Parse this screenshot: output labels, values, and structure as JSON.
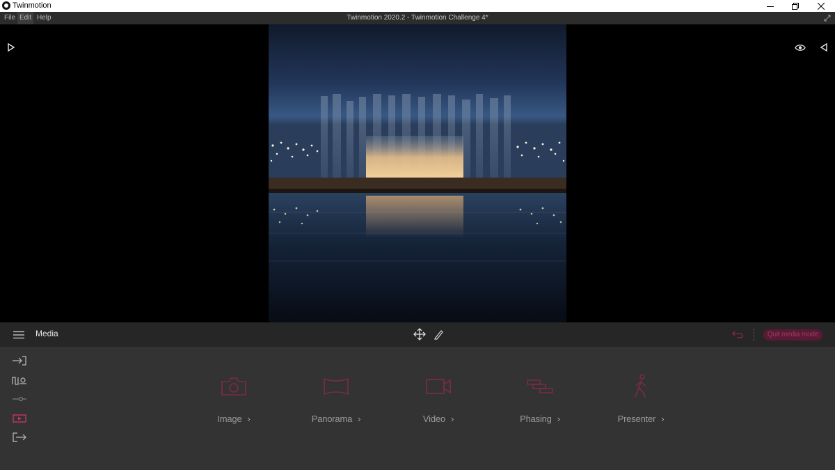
{
  "window": {
    "app_name": "Twinmotion",
    "title": "Twinmotion 2020.2 - Twinmotion Challenge 4*"
  },
  "menu": {
    "items": [
      {
        "label": "File"
      },
      {
        "label": "Edit"
      },
      {
        "label": "Help"
      }
    ]
  },
  "viewport": {
    "icons": [
      "play-right-icon",
      "eye-icon",
      "collapse-left-icon"
    ]
  },
  "media_bar": {
    "title": "Media",
    "quit_label": "Quit media mode",
    "icons": [
      "hamburger-icon",
      "move-icon",
      "pencil-icon",
      "undo-icon"
    ]
  },
  "side_nav": {
    "icons": [
      "import-icon",
      "context-icon",
      "configure-icon",
      "media-icon",
      "export-icon"
    ],
    "active": "media-icon"
  },
  "media_types": [
    {
      "label": "Image",
      "icon": "camera-icon"
    },
    {
      "label": "Panorama",
      "icon": "panorama-icon"
    },
    {
      "label": "Video",
      "icon": "video-camera-icon"
    },
    {
      "label": "Phasing",
      "icon": "phasing-icon"
    },
    {
      "label": "Presenter",
      "icon": "walking-person-icon"
    }
  ],
  "colors": {
    "accent": "#c43468",
    "accent_dim": "#5a1a35",
    "panel": "#333333",
    "toolbar": "#262626"
  }
}
